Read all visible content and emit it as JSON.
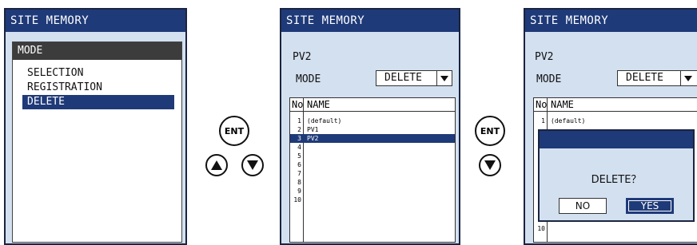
{
  "screen1": {
    "title": "SITE MEMORY",
    "mode_header": "MODE",
    "items": [
      "SELECTION",
      "REGISTRATION",
      "DELETE"
    ],
    "selected_index": 2
  },
  "controls1": {
    "ent_label": "ENT",
    "up_icon": "triangle-up-icon",
    "down_icon": "triangle-down-icon"
  },
  "screen2": {
    "title": "SITE MEMORY",
    "pv_label": "PV2",
    "mode_label": "MODE",
    "mode_value": "DELETE",
    "list": {
      "col_no": "No",
      "col_name": "NAME",
      "rows": [
        {
          "no": "1",
          "name": "(default)"
        },
        {
          "no": "2",
          "name": "PV1"
        },
        {
          "no": "3",
          "name": "PV2"
        },
        {
          "no": "4",
          "name": ""
        },
        {
          "no": "5",
          "name": ""
        },
        {
          "no": "6",
          "name": ""
        },
        {
          "no": "7",
          "name": ""
        },
        {
          "no": "8",
          "name": ""
        },
        {
          "no": "9",
          "name": ""
        },
        {
          "no": "10",
          "name": ""
        }
      ],
      "selected_no": "3"
    }
  },
  "controls2": {
    "ent_label": "ENT",
    "down_icon": "triangle-down-icon"
  },
  "screen3": {
    "title": "SITE MEMORY",
    "pv_label": "PV2",
    "mode_label": "MODE",
    "mode_value": "DELETE",
    "list": {
      "col_no": "No",
      "col_name": "NAME",
      "row1_no": "1",
      "row1_name": "(default)",
      "row10_no": "10"
    },
    "dialog": {
      "message": "DELETE？",
      "no_label": "NO",
      "yes_label": "YES"
    }
  },
  "colors": {
    "titlebar": "#1f3a78",
    "screen_bg": "#d3e0f0",
    "selection": "#1f3a78",
    "mode_header": "#3c3c3c"
  }
}
